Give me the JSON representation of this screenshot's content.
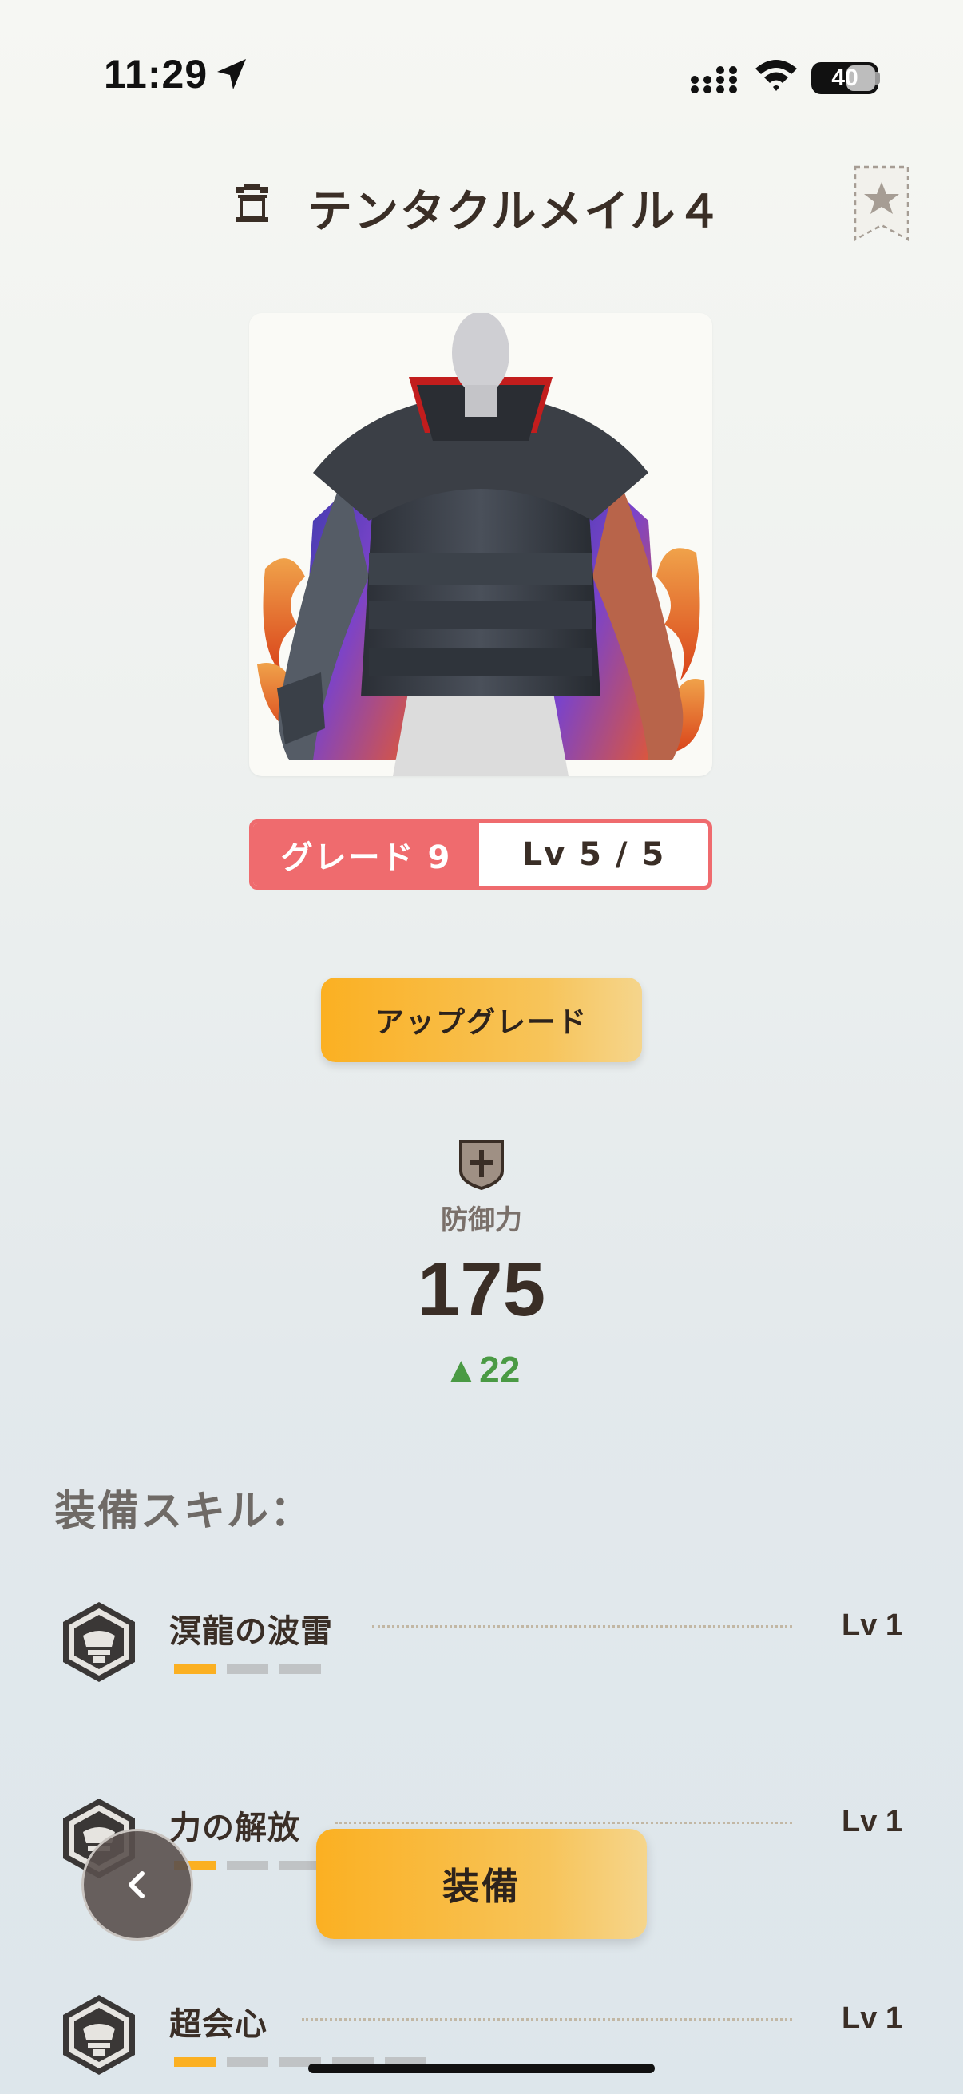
{
  "status_bar": {
    "time": "11:29",
    "battery": "40"
  },
  "header": {
    "title": "テンタクルメイル４",
    "rank_icon": "armor-rank-icon",
    "favorite_icon": "star-icon"
  },
  "item": {
    "image_icon": "armor-chest-image"
  },
  "grade": {
    "label": "グレード 9",
    "level": "Lv 5 / 5"
  },
  "upgrade": {
    "label": "アップグレード"
  },
  "defense": {
    "icon": "shield-icon",
    "label": "防御力",
    "value": "175",
    "increase": "▲22"
  },
  "skills": {
    "heading": "装備スキル：",
    "items": [
      {
        "name": "溟龍の波雷",
        "level": "Lv 1",
        "progress": "1/3"
      },
      {
        "name": "力の解放",
        "level": "Lv 1",
        "progress": "1/5"
      },
      {
        "name": "超会心",
        "level": "Lv 1",
        "progress": "1/5"
      }
    ]
  },
  "actions": {
    "equip": "装備",
    "back_icon": "chevron-left-icon"
  },
  "colors": {
    "accent": "#fbb022",
    "grade": "#ef6b6e",
    "increase": "#4a9a44"
  }
}
